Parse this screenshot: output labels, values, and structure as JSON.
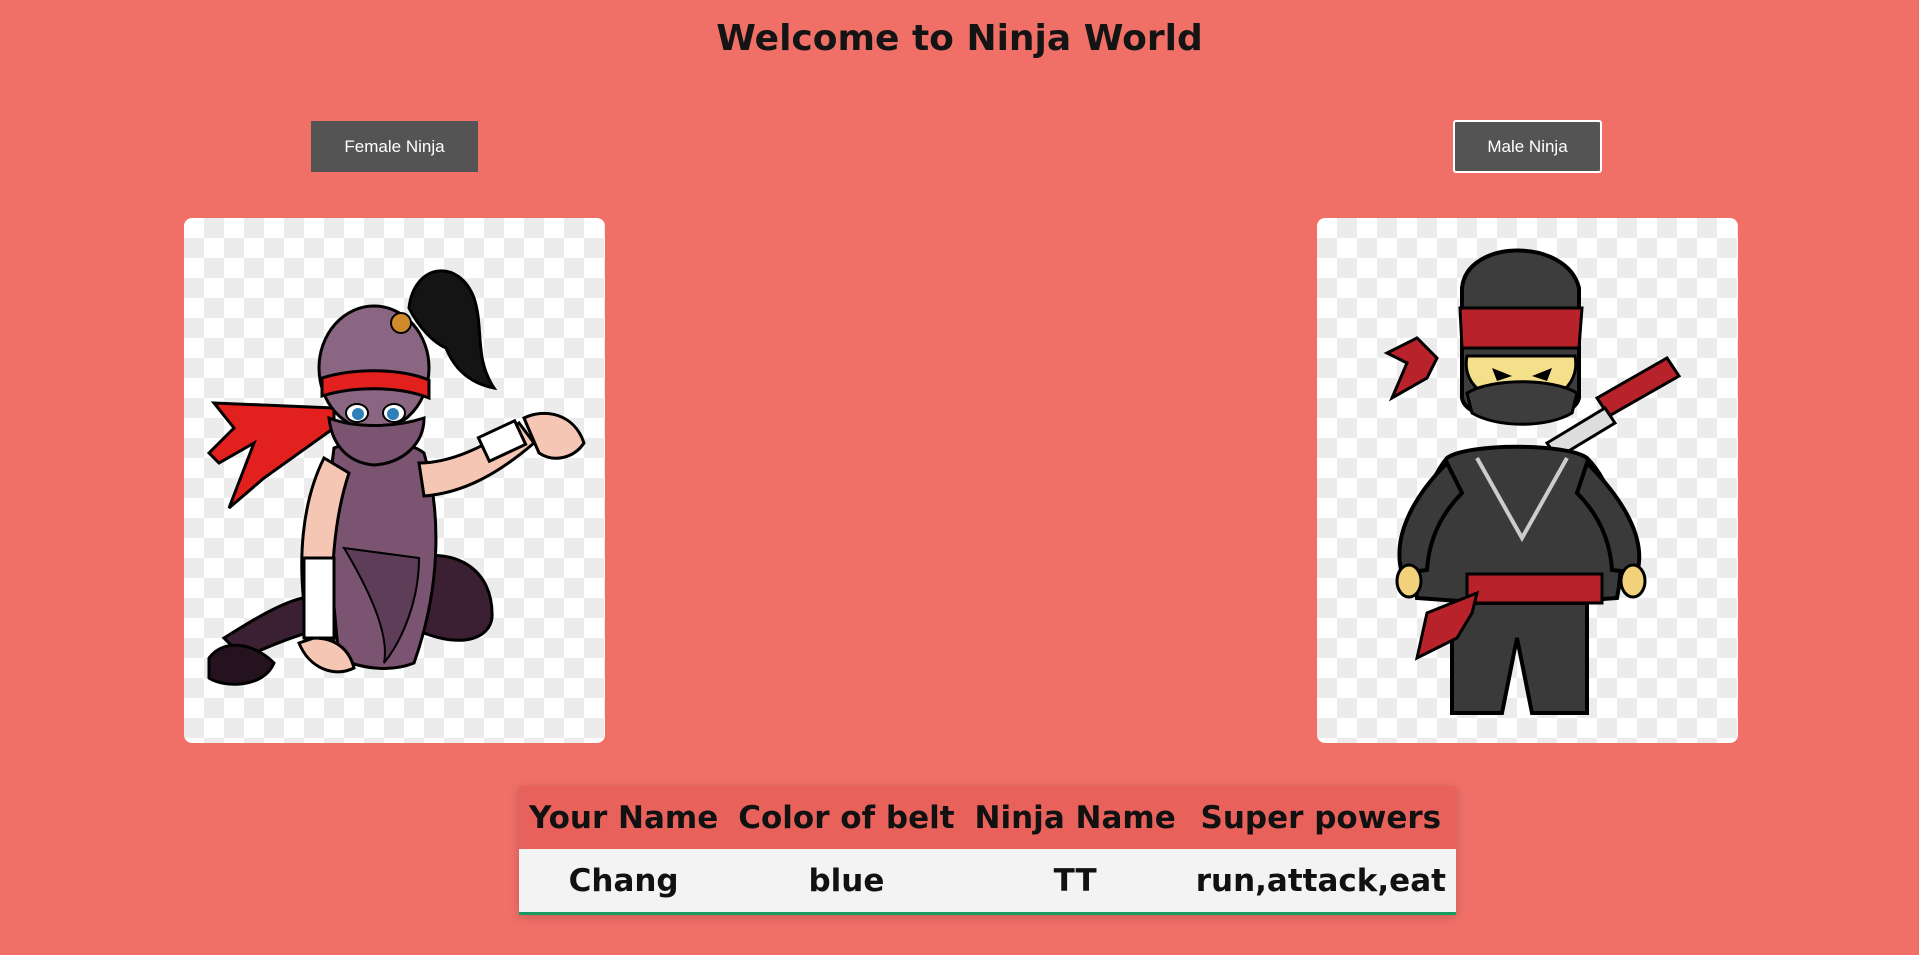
{
  "page": {
    "title": "Welcome to Ninja World"
  },
  "buttons": {
    "female_label": "Female Ninja",
    "male_label": "Male Ninja"
  },
  "images": {
    "female": "female-ninja-illustration",
    "male": "male-ninja-illustration"
  },
  "table": {
    "headers": [
      "Your Name",
      "Color of belt",
      "Ninja Name",
      "Super powers"
    ],
    "rows": [
      [
        "Chang",
        "blue",
        "TT",
        "run,attack,eat"
      ]
    ]
  },
  "colors": {
    "background": "#f07068",
    "button": "#545454",
    "table_header": "#e8625b",
    "table_row": "#f3f3f3",
    "row_border": "#169b62"
  }
}
